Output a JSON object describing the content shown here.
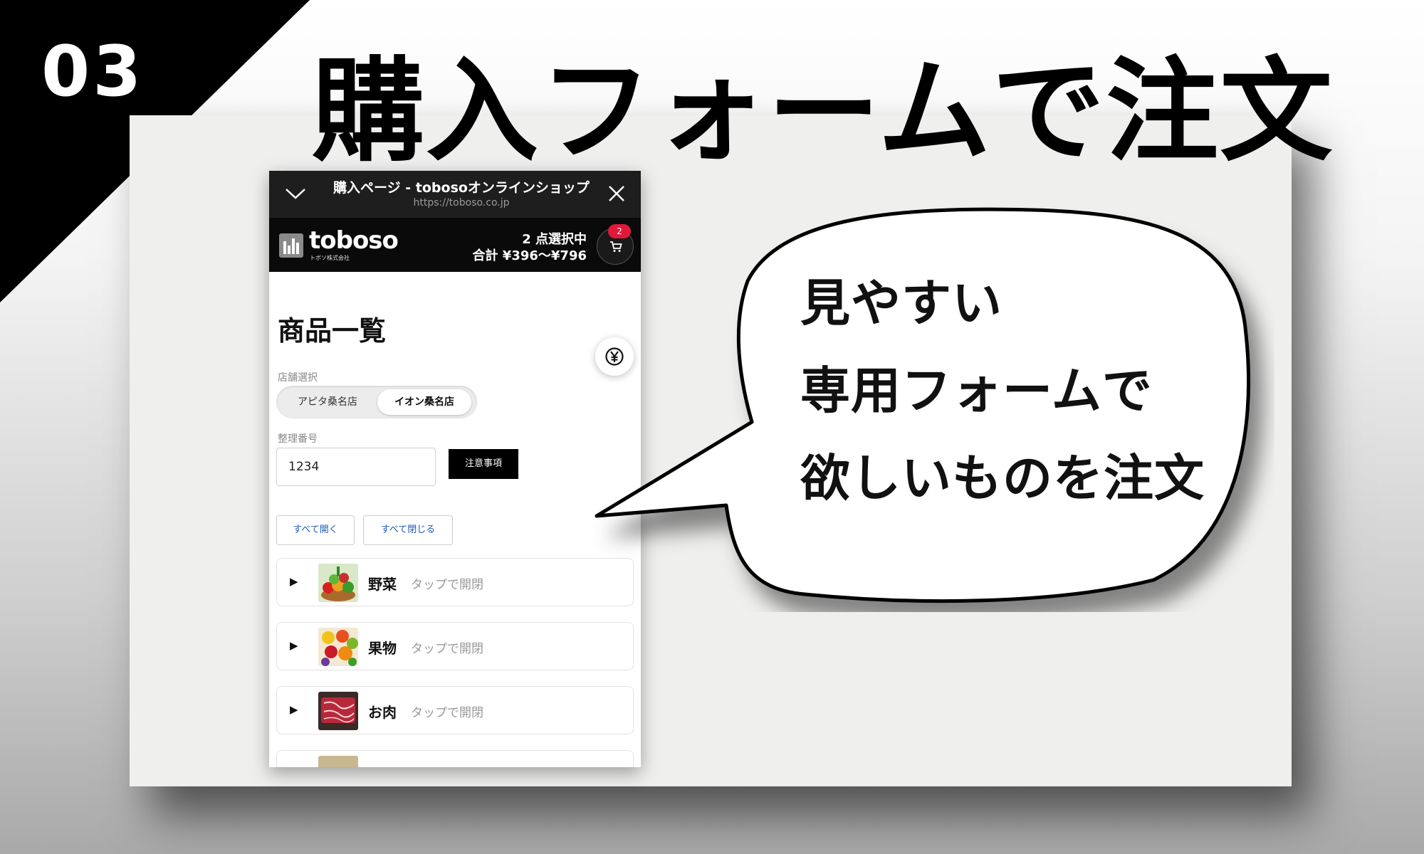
{
  "badge": {
    "number": "03"
  },
  "headline": "購入フォームで注文",
  "browser": {
    "title": "購入ページ - tobosoオンラインショップ",
    "url": "https://toboso.co.jp",
    "icons": {
      "collapse": "chevron-down-icon",
      "close": "close-icon"
    }
  },
  "site": {
    "logo_text": "toboso",
    "logo_sub": "トボソ株式会社",
    "selection_count": "2 点選択中",
    "selection_total": "合計 ¥396〜¥796",
    "cart_badge": "2"
  },
  "content": {
    "title": "商品一覧",
    "store_label": "店舗選択",
    "stores": [
      "アピタ桑名店",
      "イオン桑名店"
    ],
    "selected_store": "イオン桑名店",
    "mgmt_label": "整理番号",
    "mgmt_value": "1234",
    "notice_button": "注意事項",
    "open_all": "すべて開く",
    "close_all": "すべて閉じる",
    "categories": [
      {
        "name": "野菜",
        "hint": "タップで開閉"
      },
      {
        "name": "果物",
        "hint": "タップで開閉"
      },
      {
        "name": "お肉",
        "hint": "タップで開閉"
      }
    ]
  },
  "bubble": {
    "lines": [
      "見やすい",
      "専用フォームで",
      "欲しいものを注文"
    ]
  },
  "colors": {
    "badge": "#e0193a",
    "link": "#1e5bb8",
    "header": "#0a0a0a"
  }
}
